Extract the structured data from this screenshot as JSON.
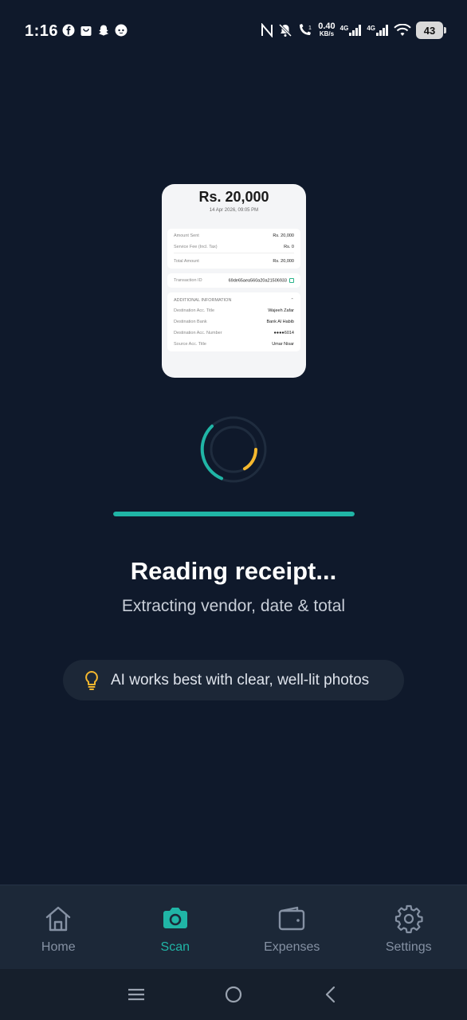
{
  "status_bar": {
    "time": "1:16",
    "net_speed_value": "0.40",
    "net_speed_unit": "KB/s",
    "signal_label_1": "4G",
    "signal_label_2": "4G",
    "battery": "43"
  },
  "receipt": {
    "amount": "Rs. 20,000",
    "date": "14 Apr 2026, 09:05 PM",
    "amount_sent_label": "Amount Sent",
    "amount_sent_value": "Rs. 20,000",
    "service_fee_label": "Service Fee (Incl. Tax)",
    "service_fee_value": "Rs. 0",
    "total_label": "Total Amount",
    "total_value": "Rs. 20,000",
    "txn_label": "Transaction ID",
    "txn_value": "69de65aea560a20a21506933",
    "additional_header": "ADDITIONAL INFORMATION",
    "dest_title_label": "Destination Acc. Title",
    "dest_title_value": "Wajeeh Zafar",
    "dest_bank_label": "Destination Bank",
    "dest_bank_value": "Bank Al Habib",
    "dest_acc_label": "Destination Acc. Number",
    "dest_acc_value": "●●●●6014",
    "source_title_label": "Source Acc. Title",
    "source_title_value": "Umar Nisar"
  },
  "progress": {
    "fraction": 1.0
  },
  "processing": {
    "title": "Reading receipt...",
    "subtitle": "Extracting vendor, date & total"
  },
  "tip": {
    "icon": "lightbulb-icon",
    "text": "AI works best with clear, well-lit photos"
  },
  "nav": {
    "items": [
      {
        "label": "Home",
        "icon": "home-icon"
      },
      {
        "label": "Scan",
        "icon": "camera-icon"
      },
      {
        "label": "Expenses",
        "icon": "wallet-icon"
      },
      {
        "label": "Settings",
        "icon": "gear-icon"
      }
    ],
    "active": "Scan"
  },
  "colors": {
    "background": "#0f192b",
    "accent": "#20b5a6",
    "spinner_secondary": "#f5b82e",
    "nav_inactive": "#8591a3"
  }
}
